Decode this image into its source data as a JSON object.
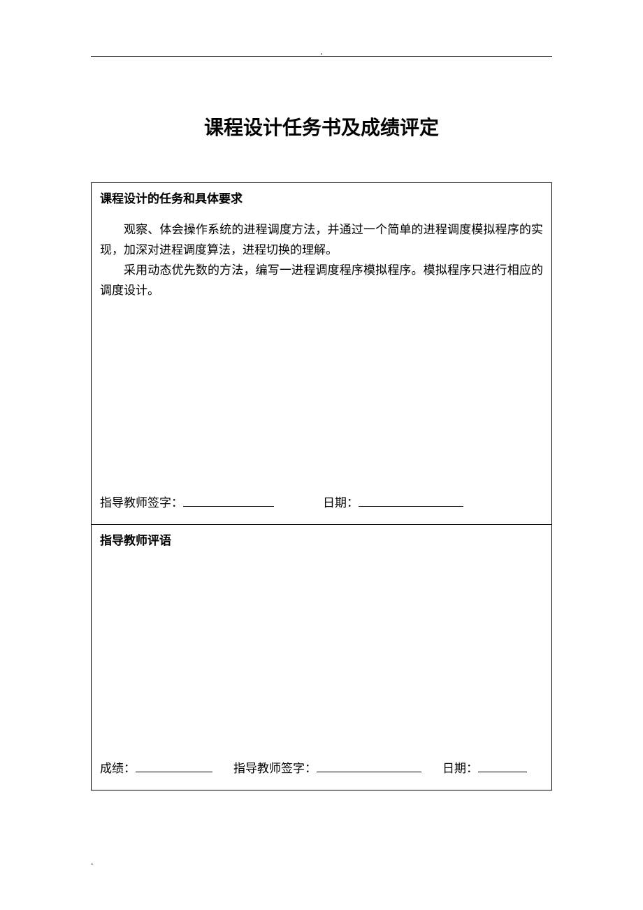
{
  "title": "课程设计任务书及成绩评定",
  "section1": {
    "heading": "课程设计的任务和具体要求",
    "para1": "观察、体会操作系统的进程调度方法，并通过一个简单的进程调度模拟程序的实现，加深对进程调度算法，进程切换的理解。",
    "para2": "采用动态优先数的方法，编写一进程调度程序模拟程序。模拟程序只进行相应的调度设计。",
    "teacher_sign_label": "指导教师签字：",
    "date_label": "日期："
  },
  "section2": {
    "heading": "指导教师评语",
    "grade_label": "成绩：",
    "teacher_sign_label": "指导教师签字：",
    "date_label": "日期："
  }
}
